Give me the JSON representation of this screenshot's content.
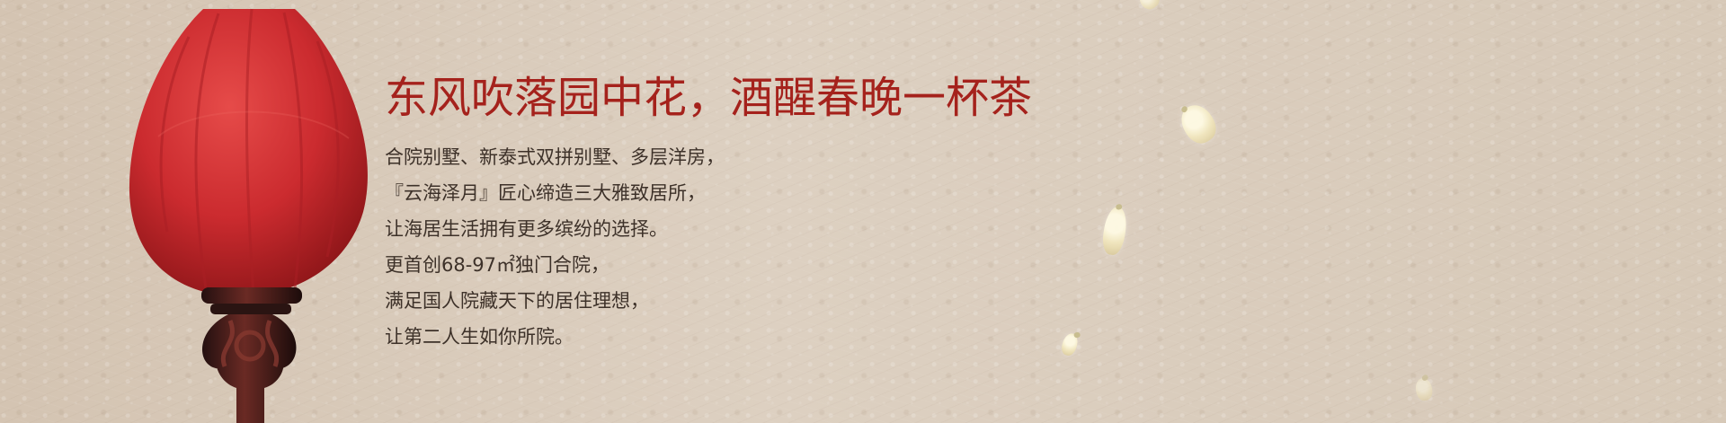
{
  "banner": {
    "headline": "东风吹落园中花，酒醒春晚一杯茶",
    "body_lines": [
      "合院别墅、新泰式双拼别墅、多层洋房，",
      "『云海泽月』匠心缔造三大雅致居所，",
      "让海居生活拥有更多缤纷的选择。",
      "更首创68-97㎡独门合院，",
      "满足国人院藏天下的居住理想，",
      "让第二人生如你所院。"
    ]
  },
  "colors": {
    "background": "#d8cbbb",
    "headline": "#a5221c",
    "body_text": "#3d3129",
    "lantern_red": "#c9292c",
    "lantern_stand": "#4b1f1b",
    "petal": "#f4edc8"
  },
  "icons": {
    "decoration": "red-lantern-icon",
    "petals": "flower-petal-icon"
  }
}
